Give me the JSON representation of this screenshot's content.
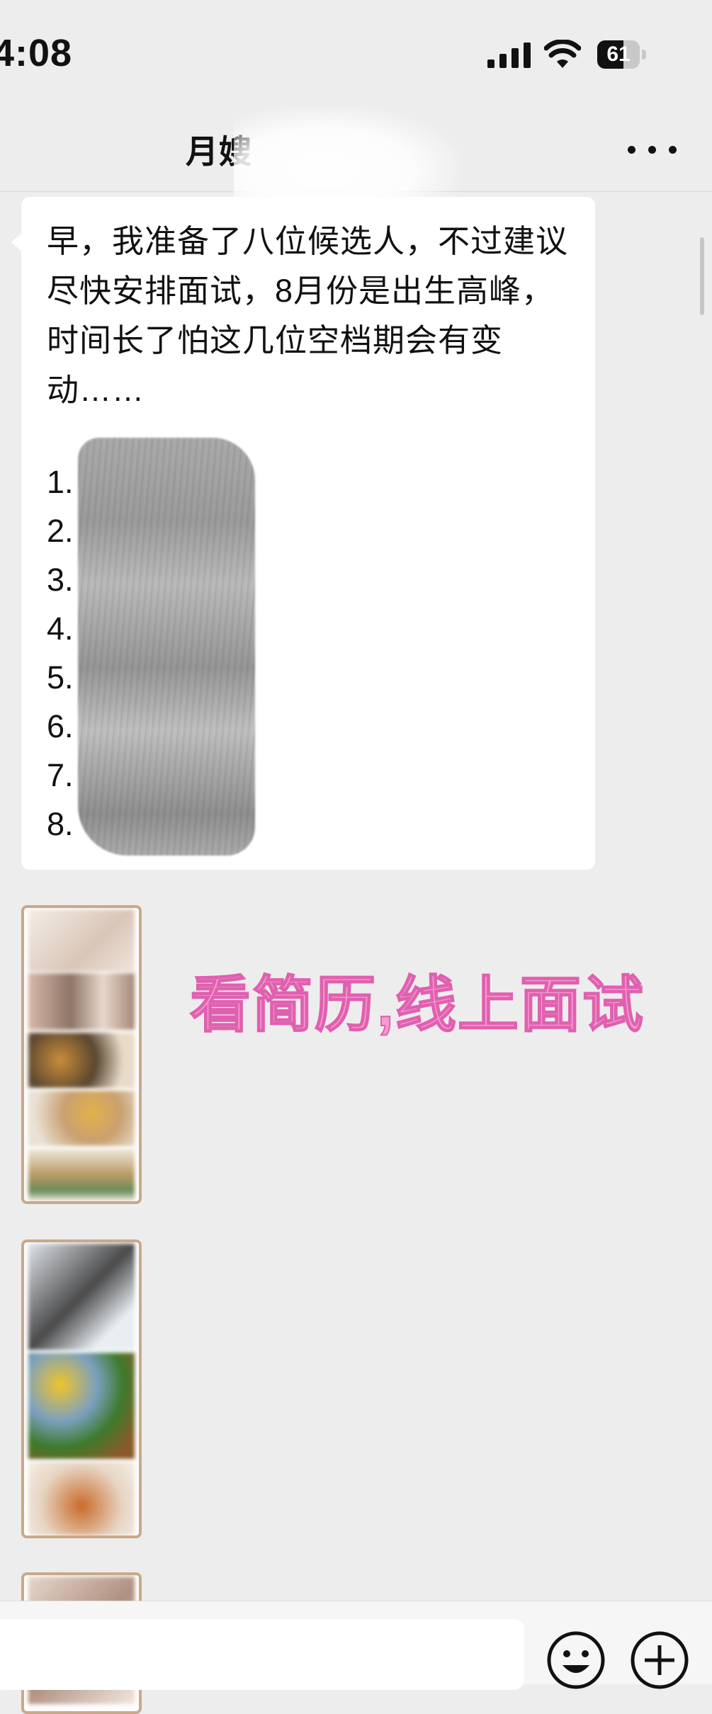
{
  "status_bar": {
    "time": "4:08",
    "battery_level": "61",
    "battery_fraction": 0.61,
    "icons": [
      "cellular-signal-icon",
      "wifi-icon",
      "battery-icon"
    ]
  },
  "header": {
    "title": "月嫂",
    "more_icon": "more-dots-icon"
  },
  "message": {
    "text": "早，我准备了八位候选人，不过建议尽快安排面试，8月份是出生高峰，时间长了怕这几位空档期会有变动……",
    "list_numbers": [
      "1.",
      "2.",
      "3.",
      "4.",
      "5.",
      "6.",
      "7.",
      "8."
    ]
  },
  "annotation": "看简历,线上面试",
  "images": [
    {
      "name": "resume-image-1",
      "icon": "image-thumbnail"
    },
    {
      "name": "resume-image-2",
      "icon": "image-thumbnail"
    },
    {
      "name": "resume-image-3",
      "icon": "image-thumbnail"
    }
  ],
  "input_bar": {
    "emoji_icon": "emoji-icon",
    "plus_icon": "plus-icon"
  },
  "colors": {
    "background": "#ededed",
    "bubble": "#ffffff",
    "annotation": "#f79ad0",
    "image_border": "#c9a98a"
  }
}
